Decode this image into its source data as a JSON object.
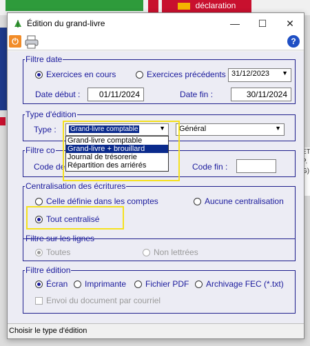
{
  "background": {
    "declaration_label": "déclaration",
    "right_strip": [
      "ET",
      "P.",
      "G)"
    ]
  },
  "window": {
    "title": "Édition du grand-livre",
    "minimize": "—",
    "maximize": "☐",
    "close": "✕"
  },
  "toolbar": {
    "power_icon": "power-icon",
    "printer_icon": "printer-icon",
    "help_label": "?"
  },
  "filtre_date": {
    "legend": "Filtre date",
    "exercices_en_cours": "Exercices en cours",
    "exercices_precedents": "Exercices précédents",
    "selected": "exercices_en_cours",
    "exercise_date": "31/12/2023",
    "date_debut_label": "Date début :",
    "date_debut": "01/11/2024",
    "date_fin_label": "Date fin :",
    "date_fin": "30/11/2024"
  },
  "type_edition": {
    "legend": "Type d'édition",
    "type_label": "Type :",
    "type_value": "Grand-livre comptable",
    "options": [
      "Grand-livre comptable",
      "Grand-livre + brouillard",
      "Journal de trésorerie",
      "Répartition des arriérés"
    ],
    "highlighted_option": 1,
    "second_value": "Général"
  },
  "filtre_comptes": {
    "legend_visible": "Filtre co",
    "code_de_label_visible": "Code de",
    "code_fin_label": "Code fin :",
    "code_fin_value": ""
  },
  "centralisation": {
    "legend": "Centralisation des écritures",
    "celle_definie": "Celle définie dans les comptes",
    "aucune": "Aucune centralisation",
    "tout": "Tout centralisé",
    "selected": "tout"
  },
  "filtre_lignes": {
    "legend": "Filtre sur les lignes",
    "toutes": "Toutes",
    "non_lettrees": "Non lettrées"
  },
  "filtre_edition": {
    "legend": "Filtre édition",
    "ecran": "Écran",
    "imprimante": "Imprimante",
    "fichier_pdf": "Fichier PDF",
    "archivage": "Archivage FEC (*.txt)",
    "selected": "ecran",
    "envoi": "Envoi du document par courriel"
  },
  "status": {
    "text": "Choisir le type d'édition"
  },
  "colors": {
    "accent": "#1a1a9c",
    "highlight": "#f5e11d",
    "selection": "#0a2a8c"
  }
}
